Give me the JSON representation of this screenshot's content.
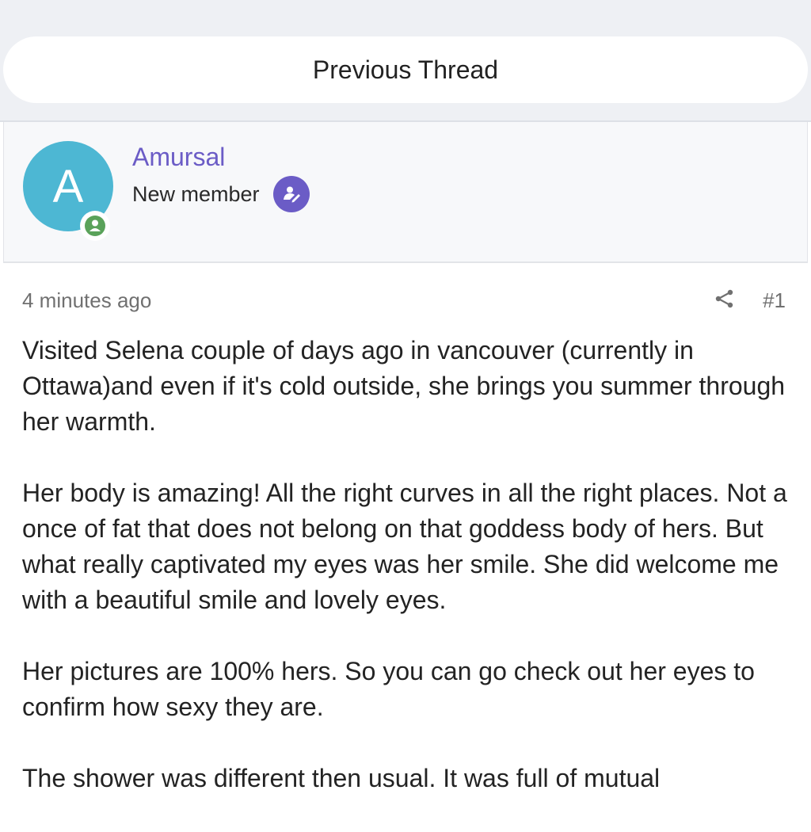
{
  "nav": {
    "previous_thread": "Previous Thread"
  },
  "user": {
    "avatar_letter": "A",
    "name": "Amursal",
    "title": "New member",
    "avatar_color": "#4db7d3",
    "name_color": "#6b5cc6",
    "online_color": "#5aa25a",
    "online_icon": "user-online-icon",
    "title_icon": "member-pen-icon"
  },
  "post": {
    "timestamp": "4 minutes ago",
    "share_icon": "share-icon",
    "number": "#1",
    "paragraphs": [
      "Visited Selena couple of days ago in vancouver (currently in Ottawa)and even if it's cold outside, she brings you summer through her warmth.",
      "Her body is amazing! All the right curves in all the right places. Not a once of fat that does not belong on that goddess body of hers. But what really captivated my eyes was her smile. She did welcome me with a beautiful smile and lovely eyes.",
      "Her pictures are 100% hers. So you can go check out her eyes to confirm how sexy they are.",
      "The shower was different then usual. It was full of mutual"
    ]
  }
}
